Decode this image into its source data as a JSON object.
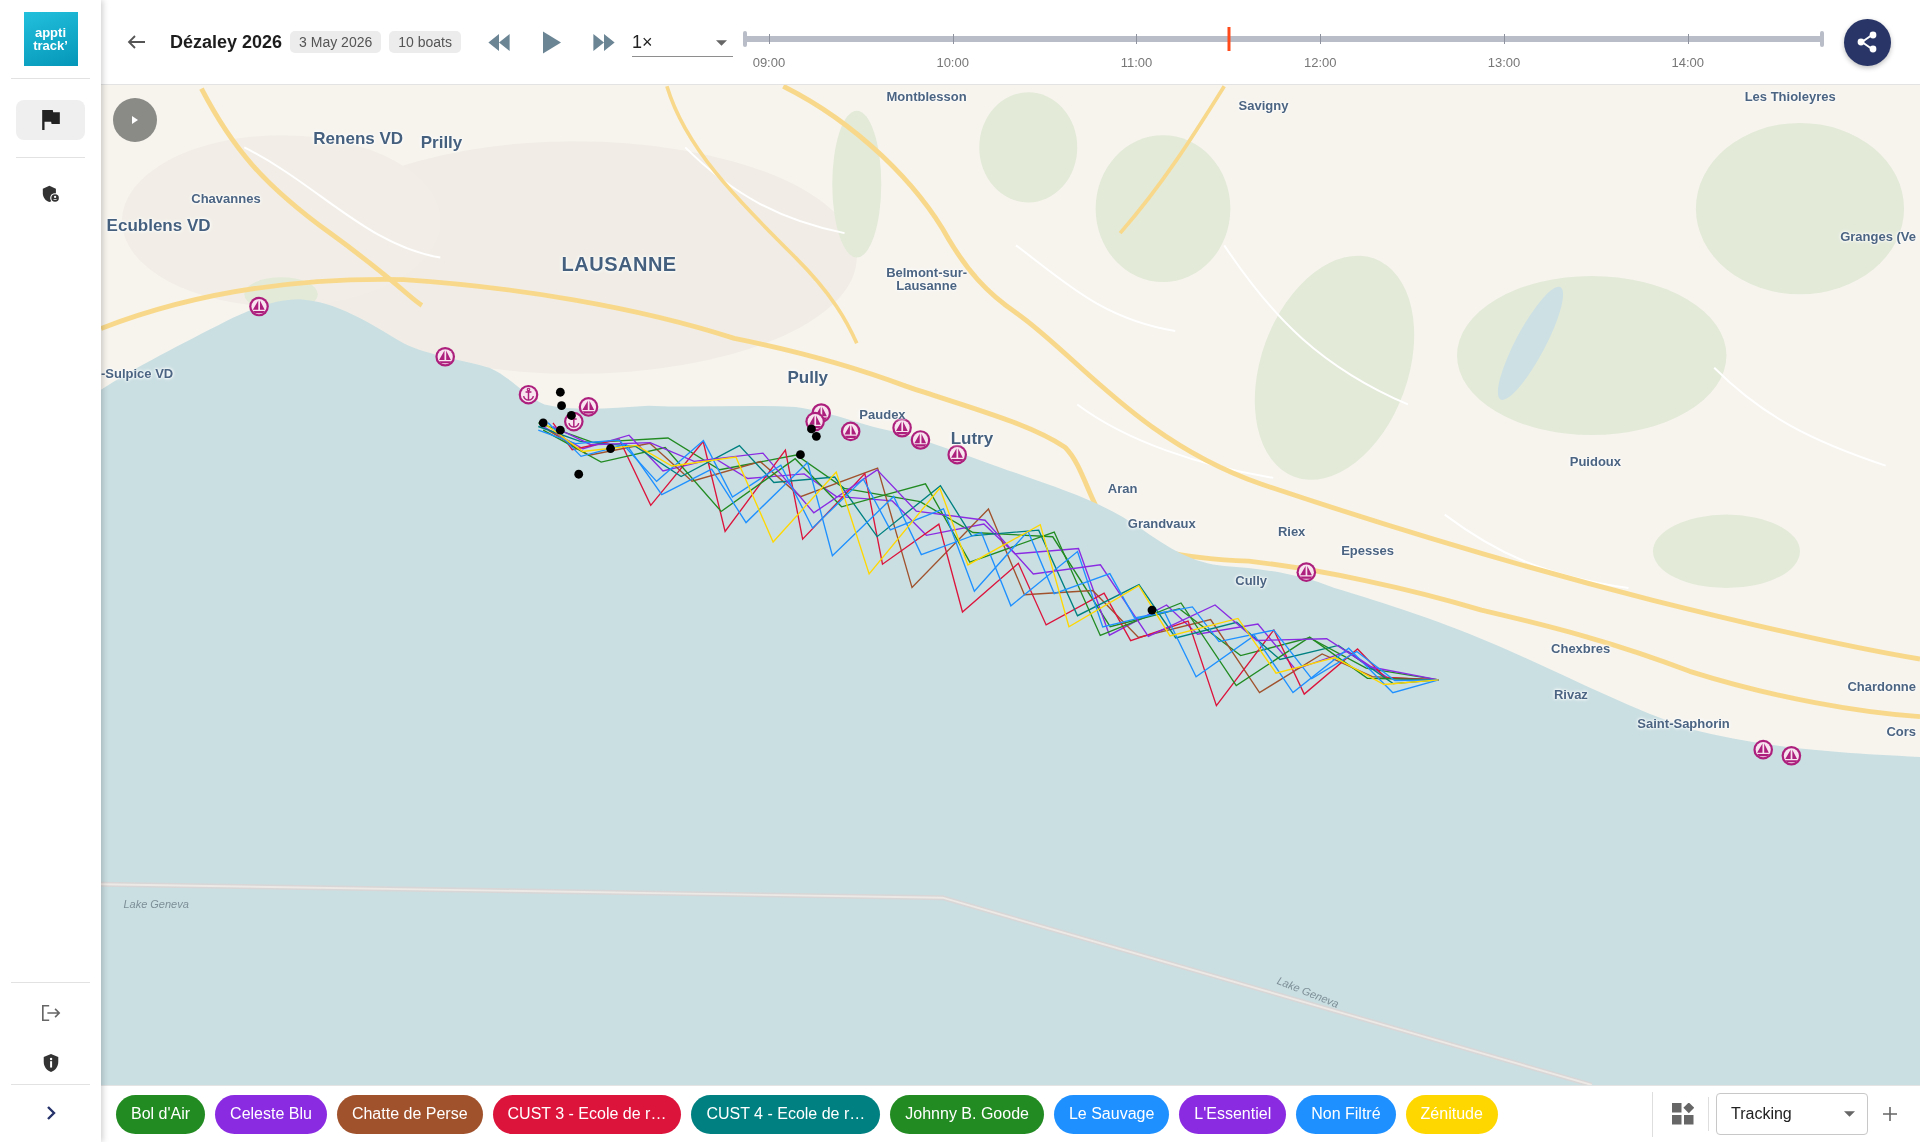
{
  "sidebar": {
    "logo": [
      "appti",
      "track’"
    ],
    "nav": [
      {
        "selected": true
      },
      {
        "selected": false
      }
    ]
  },
  "header": {
    "title": "Dézaley 2026",
    "date": "3 May 2026",
    "boat_count": "10 boats",
    "speed": {
      "value": "1×"
    },
    "timeline": {
      "ticks": [
        "09:00",
        "10:00",
        "11:00",
        "12:00",
        "13:00",
        "14:00"
      ],
      "level": 0.45
    }
  },
  "map": {
    "places": [
      {
        "name": "Montblesson"
      },
      {
        "name": "Savigny"
      },
      {
        "name": "Les Thioleyres"
      },
      {
        "name": "Renens VD"
      },
      {
        "name": "Prilly"
      },
      {
        "name": "Chavannes"
      },
      {
        "name": "Ecublens VD"
      },
      {
        "name": "LAUSANNE"
      },
      {
        "name": "Belmont-sur-Lausanne"
      },
      {
        "name": "Granges (Ve"
      },
      {
        "name": "-Sulpice VD"
      },
      {
        "name": "Pully"
      },
      {
        "name": "Paudex"
      },
      {
        "name": "Lutry"
      },
      {
        "name": "Puidoux"
      },
      {
        "name": "Aran"
      },
      {
        "name": "Grandvaux"
      },
      {
        "name": "Riex"
      },
      {
        "name": "Epesses"
      },
      {
        "name": "Cully"
      },
      {
        "name": "Chexbres"
      },
      {
        "name": "Chardonne"
      },
      {
        "name": "Rivaz"
      },
      {
        "name": "Saint-Saphorin"
      },
      {
        "name": "Cors"
      }
    ],
    "water_labels": [
      "Lake Geneva",
      "Lake Geneva"
    ]
  },
  "boats": [
    {
      "name": "Bol d'Air",
      "color": "#228b22"
    },
    {
      "name": "Celeste Blu",
      "color": "#8a2be2"
    },
    {
      "name": "Chatte de Perse",
      "color": "#a0522d"
    },
    {
      "name": "CUST 3 - Ecole de r…",
      "color": "#dc143c"
    },
    {
      "name": "CUST 4 - Ecole de r…",
      "color": "#008080"
    },
    {
      "name": "Johnny B. Goode",
      "color": "#228b22"
    },
    {
      "name": "Le Sauvage",
      "color": "#1e90ff"
    },
    {
      "name": "L'Essentiel",
      "color": "#8a2be2"
    },
    {
      "name": "Non Filtré",
      "color": "#1e90ff"
    },
    {
      "name": "Zénitude",
      "color": "#ffd700"
    }
  ],
  "view_select": {
    "value": "Tracking"
  }
}
